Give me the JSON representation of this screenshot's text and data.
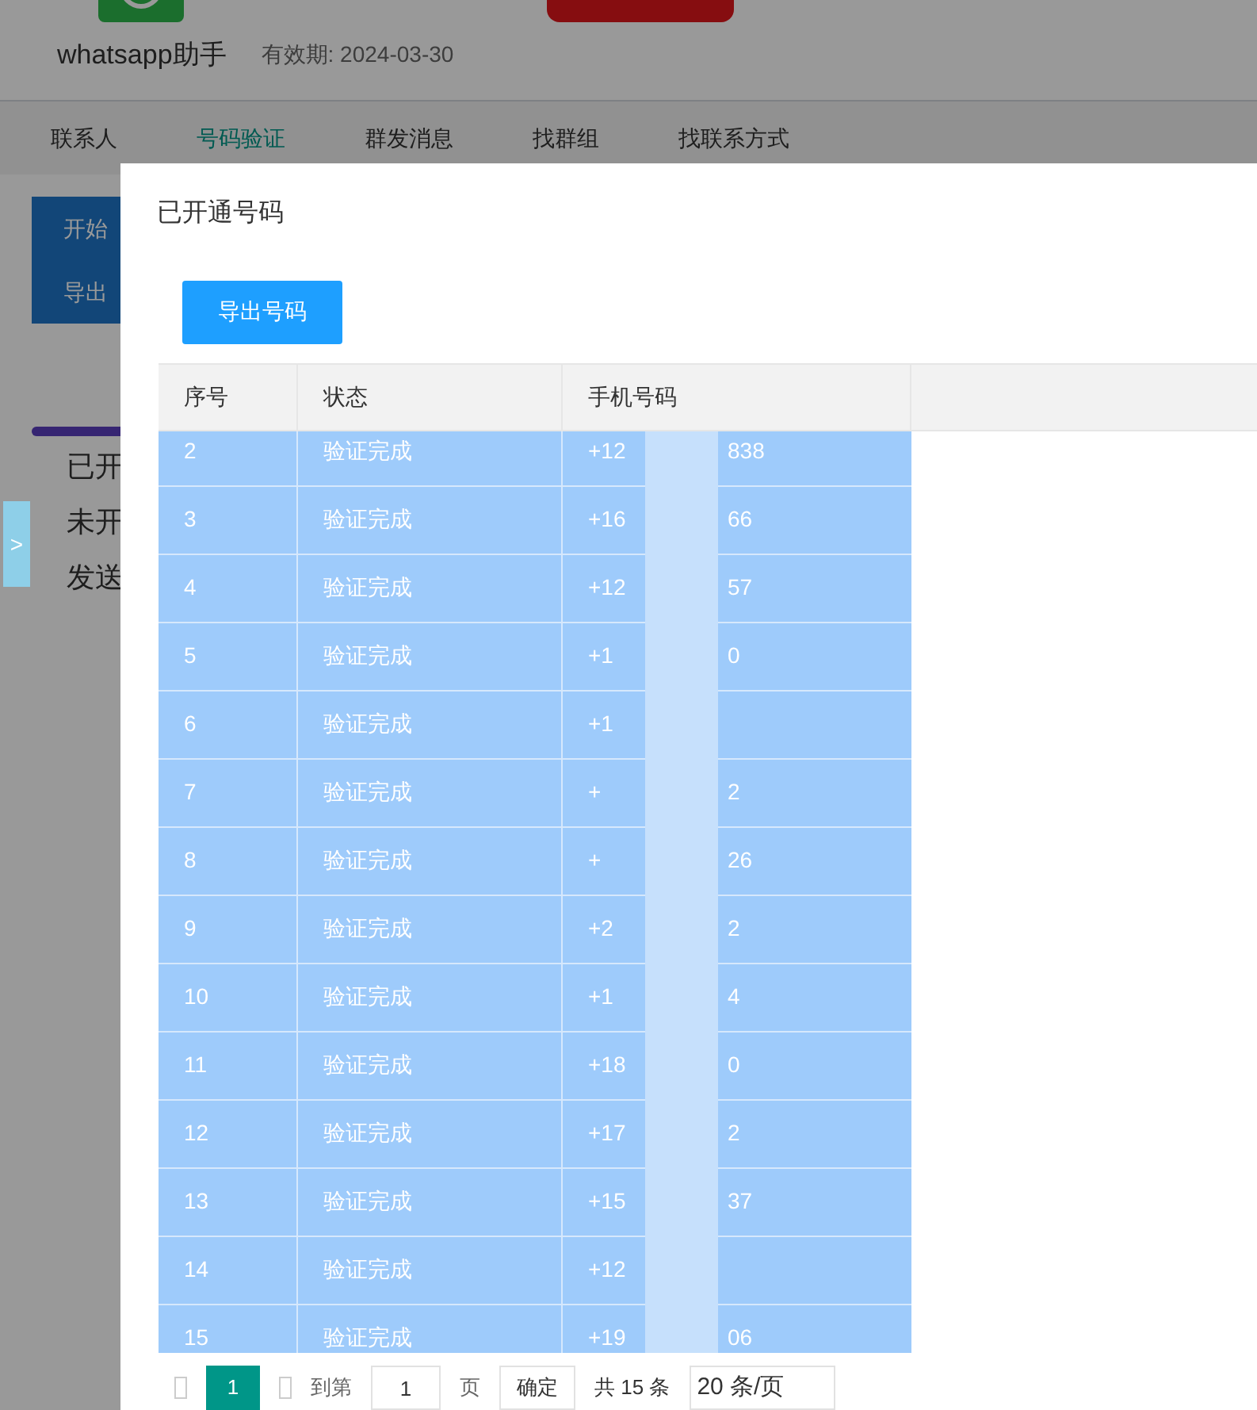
{
  "app": {
    "name": "whatsapp助手",
    "expiry": "有效期: 2024-03-30"
  },
  "nav_tabs": [
    {
      "label": "联系人",
      "selected": false
    },
    {
      "label": "号码验证",
      "selected": true
    },
    {
      "label": "群发消息",
      "selected": false
    },
    {
      "label": "找群组",
      "selected": false
    },
    {
      "label": "找联系方式",
      "selected": false
    }
  ],
  "side_buttons": [
    "开始",
    "导出"
  ],
  "progress": {
    "level": 1
  },
  "stats": [
    "已开",
    "未开",
    "发送"
  ],
  "side_toggle": ">",
  "dialog": {
    "title": "已开通号码",
    "export_button": "导出号码",
    "table": {
      "columns": [
        "序号",
        "状态",
        "手机号码"
      ],
      "rows": [
        {
          "index": "2",
          "status": "验证完成",
          "phone_start": "+12",
          "phone_end": "838"
        },
        {
          "index": "3",
          "status": "验证完成",
          "phone_start": "+16",
          "phone_end": "66"
        },
        {
          "index": "4",
          "status": "验证完成",
          "phone_start": "+12",
          "phone_end": "57"
        },
        {
          "index": "5",
          "status": "验证完成",
          "phone_start": "+1",
          "phone_end": "0"
        },
        {
          "index": "6",
          "status": "验证完成",
          "phone_start": "+1"
        },
        {
          "index": "7",
          "status": "验证完成",
          "phone_start": "+",
          "phone_end": "2"
        },
        {
          "index": "8",
          "status": "验证完成",
          "phone_start": "+",
          "phone_end": "26"
        },
        {
          "index": "9",
          "status": "验证完成",
          "phone_start": "+2",
          "phone_end": "2"
        },
        {
          "index": "10",
          "status": "验证完成",
          "phone_start": "+1",
          "phone_end": "4"
        },
        {
          "index": "11",
          "status": "验证完成",
          "phone_start": "+18",
          "phone_end": "0"
        },
        {
          "index": "12",
          "status": "验证完成",
          "phone_start": "+17",
          "phone_end": "2"
        },
        {
          "index": "13",
          "status": "验证完成",
          "phone_start": "+15",
          "phone_end": "37"
        },
        {
          "index": "14",
          "status": "验证完成",
          "phone_start": "+12"
        },
        {
          "index": "15",
          "status": "验证完成",
          "phone_start": "+19",
          "phone_end": "06"
        }
      ]
    },
    "pagination": {
      "pages": [
        {
          "label": "1",
          "selected": true
        }
      ],
      "goto_label": "到第",
      "page_input": "1",
      "page_unit": "页",
      "confirm": "确定",
      "total": "共 15 条",
      "page_size": "20 条/页"
    }
  }
}
